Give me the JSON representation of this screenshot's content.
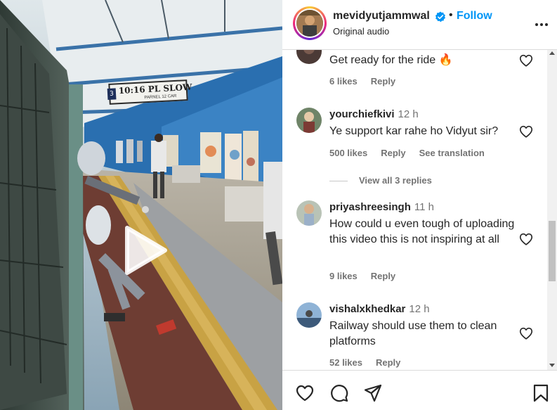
{
  "video": {
    "sign_number": "3",
    "sign_text": "10:16 PL SLOW",
    "sign_sub": "PARNEL 12 CAR"
  },
  "post": {
    "username": "mevidyutjammwal",
    "separator": "•",
    "follow_label": "Follow",
    "audio_label": "Original audio",
    "verified_icon": "verified-badge-icon",
    "more_icon": "more-options-icon"
  },
  "comments": [
    {
      "text": "Get ready for the ride 🔥",
      "likes": "6 likes",
      "reply": "Reply"
    },
    {
      "username": "yourchiefkivi",
      "time": "12 h",
      "text": "Ye support kar rahe ho Vidyut sir?",
      "likes": "500 likes",
      "reply": "Reply",
      "translation": "See translation",
      "view_replies": "View all 3 replies"
    },
    {
      "username": "priyashreesingh",
      "time": "11 h",
      "text": "How could u even tough of uploading this video this is not inspiring at all",
      "likes": "9 likes",
      "reply": "Reply"
    },
    {
      "username": "vishalxkhedkar",
      "time": "12 h",
      "text": "Railway should use them to clean platforms",
      "likes": "52 likes",
      "reply": "Reply"
    }
  ],
  "actions": {
    "like_icon": "heart-icon",
    "comment_icon": "comment-icon",
    "share_icon": "share-icon",
    "save_icon": "bookmark-icon"
  },
  "colors": {
    "follow": "#0095f6",
    "text": "#262626",
    "secondary": "#737373",
    "border": "#dbdbdb"
  }
}
